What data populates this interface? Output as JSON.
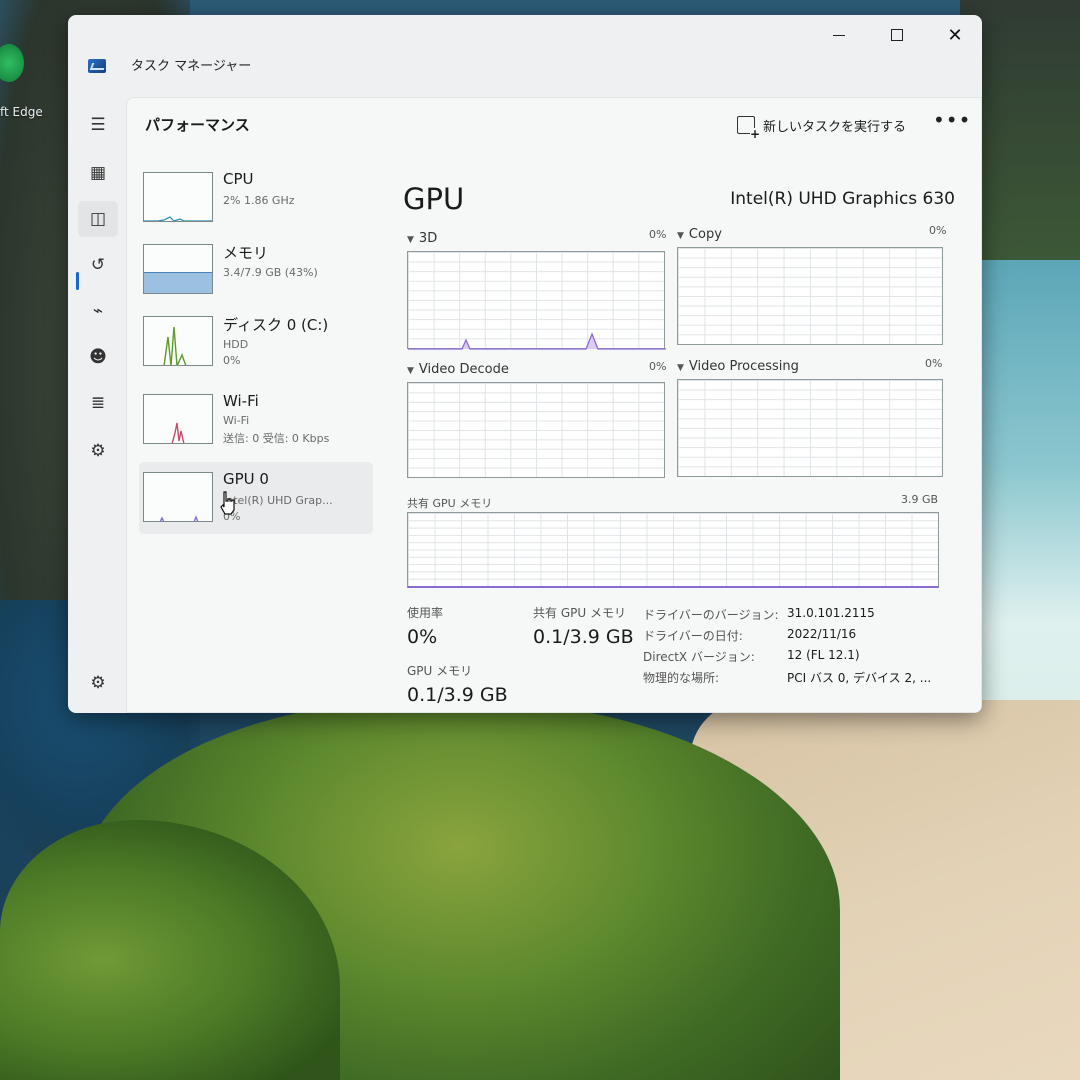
{
  "desktop": {
    "edge_label": "ft Edge"
  },
  "window": {
    "title": "タスク マネージャー",
    "close_glyph": "✕"
  },
  "toolbar": {
    "page_title": "パフォーマンス",
    "run_new_task": "新しいタスクを実行する",
    "more_glyph": "•••"
  },
  "nav": {
    "menu_glyph": "☰",
    "processes_glyph": "▦",
    "performance_glyph": "◫",
    "history_glyph": "↺",
    "startup_glyph": "⌁",
    "users_glyph": "☻",
    "details_glyph": "≣",
    "services_glyph": "⚙",
    "settings_glyph": "⚙"
  },
  "resources": [
    {
      "name": "CPU",
      "line1": "2%  1.86 GHz",
      "line2": "",
      "line3": ""
    },
    {
      "name": "メモリ",
      "line1": "3.4/7.9 GB (43%)",
      "line2": "",
      "line3": ""
    },
    {
      "name": "ディスク 0 (C:)",
      "line1": "HDD",
      "line2": "0%",
      "line3": ""
    },
    {
      "name": "Wi-Fi",
      "line1": "Wi-Fi",
      "line2": "送信: 0  受信: 0 Kbps",
      "line3": ""
    },
    {
      "name": "GPU 0",
      "line1": "Intel(R) UHD Grap...",
      "line2": "0%",
      "line3": ""
    }
  ],
  "resource_levels": {
    "memory_used_fraction": 0.43
  },
  "gpu": {
    "title": "GPU",
    "model": "Intel(R) UHD Graphics 630",
    "engines": [
      {
        "name": "3D",
        "percent": "0%"
      },
      {
        "name": "Copy",
        "percent": "0%"
      },
      {
        "name": "Video Decode",
        "percent": "0%"
      },
      {
        "name": "Video Processing",
        "percent": "0%"
      }
    ],
    "shared_memory_graph": {
      "label": "共有 GPU メモリ",
      "max": "3.9 GB"
    },
    "stats": {
      "utilization_label": "使用率",
      "utilization_value": "0%",
      "shared_mem_label": "共有 GPU メモリ",
      "shared_mem_value": "0.1/3.9 GB",
      "gpu_mem_label": "GPU メモリ",
      "gpu_mem_value": "0.1/3.9 GB"
    },
    "info": [
      {
        "key": "ドライバーのバージョン:",
        "value": "31.0.101.2115"
      },
      {
        "key": "ドライバーの日付:",
        "value": "2022/11/16"
      },
      {
        "key": "DirectX バージョン:",
        "value": "12 (FL 12.1)"
      },
      {
        "key": "物理的な場所:",
        "value": "PCI バス 0, デバイス 2, ..."
      }
    ]
  },
  "colors": {
    "accent": "#1a66c9",
    "gpu_line": "#8a6bd6",
    "cpu_line": "#2b8ab8",
    "memory_fill": "#9cc0e0",
    "disk_line": "#5f9a2a",
    "wifi_line": "#c64a6a"
  }
}
